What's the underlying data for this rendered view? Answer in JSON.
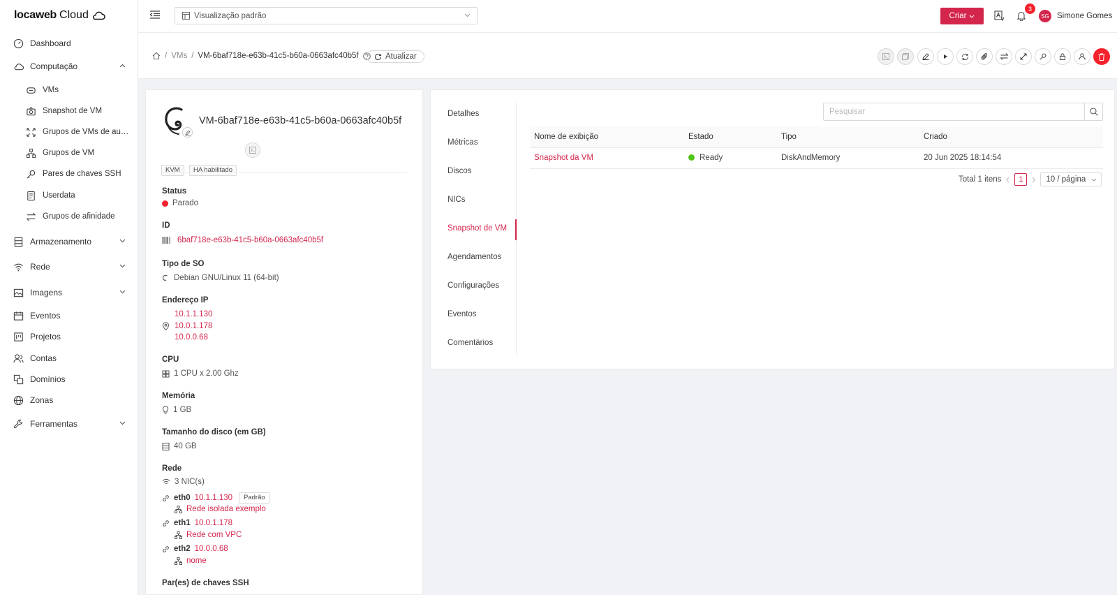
{
  "brand": {
    "name_bold": "locaweb",
    "name_light": "Cloud"
  },
  "sidebar": {
    "items": [
      {
        "label": "Dashboard"
      },
      {
        "label": "Computação"
      },
      {
        "label": "VMs"
      },
      {
        "label": "Snapshot de VM"
      },
      {
        "label": "Grupos de VMs de auto..."
      },
      {
        "label": "Grupos de VM"
      },
      {
        "label": "Pares de chaves SSH"
      },
      {
        "label": "Userdata"
      },
      {
        "label": "Grupos de afinidade"
      },
      {
        "label": "Armazenamento"
      },
      {
        "label": "Rede"
      },
      {
        "label": "Imagens"
      },
      {
        "label": "Eventos"
      },
      {
        "label": "Projetos"
      },
      {
        "label": "Contas"
      },
      {
        "label": "Domínios"
      },
      {
        "label": "Zonas"
      },
      {
        "label": "Ferramentas"
      }
    ]
  },
  "header": {
    "view_select": "Visualização padrão",
    "create_label": "Criar",
    "notifications": "3",
    "avatar_initials": "SG",
    "user_name": "Simone Gomes"
  },
  "breadcrumb": {
    "vms": "VMs",
    "current": "VM-6baf718e-e63b-41c5-b60a-0663afc40b5f",
    "refresh": "Atualizar"
  },
  "vm": {
    "title": "VM-6baf718e-e63b-41c5-b60a-0663afc40b5f",
    "tags": [
      "KVM",
      "HA habilitado"
    ],
    "status_label": "Status",
    "status_value": "Parado",
    "id_label": "ID",
    "id_value": "6baf718e-e63b-41c5-b60a-0663afc40b5f",
    "os_label": "Tipo de SO",
    "os_value": "Debian GNU/Linux 11 (64-bit)",
    "ip_label": "Endereço IP",
    "ips": [
      "10.1.1.130",
      "10.0.1.178",
      "10.0.0.68"
    ],
    "cpu_label": "CPU",
    "cpu_value": "1 CPU x 2.00 Ghz",
    "mem_label": "Memória",
    "mem_value": "1 GB",
    "disk_label": "Tamanho do disco (em GB)",
    "disk_value": "40 GB",
    "net_label": "Rede",
    "nic_count": "3 NIC(s)",
    "nics": [
      {
        "name": "eth0",
        "ip": "10.1.1.130",
        "network": "Rede isolada exemplo",
        "badge": "Padrão"
      },
      {
        "name": "eth1",
        "ip": "10.0.1.178",
        "network": "Rede com VPC"
      },
      {
        "name": "eth2",
        "ip": "10.0.0.68",
        "network": "nome"
      }
    ],
    "ssh_label": "Par(es) de chaves SSH"
  },
  "tabs": [
    "Detalhes",
    "Métricas",
    "Discos",
    "NICs",
    "Snapshot de VM",
    "Agendamentos",
    "Configurações",
    "Eventos",
    "Comentários"
  ],
  "snapshots": {
    "search_placeholder": "Pesquisar",
    "columns": [
      "Nome de exibição",
      "Estado",
      "Tipo",
      "Criado"
    ],
    "rows": [
      {
        "name": "Snapshot da VM",
        "state": "Ready",
        "type": "DiskAndMemory",
        "created": "20 Jun 2025 18:14:54"
      }
    ],
    "total": "Total 1 itens",
    "page": "1",
    "page_size": "10 / página"
  },
  "colors": {
    "accent": "#d4264c",
    "stopped": "#f5222d",
    "ready": "#52c41a"
  }
}
